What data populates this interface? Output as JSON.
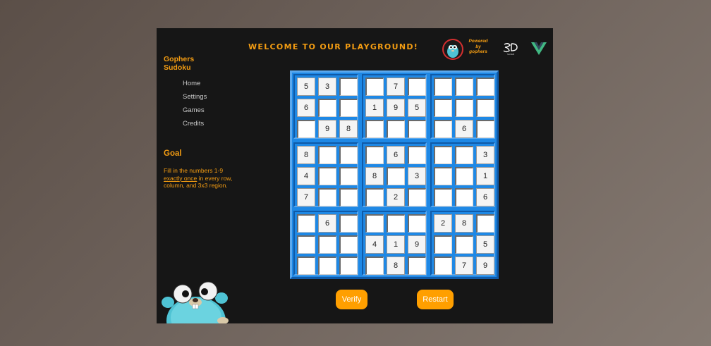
{
  "sidebar": {
    "brand": "Gophers Sudoku",
    "nav": [
      "Home",
      "Settings",
      "Games",
      "Credits"
    ],
    "goal_title": "Goal",
    "goal_text_before": "Fill in the numbers 1-9 ",
    "goal_text_emphasis": "exactly once",
    "goal_text_after": " in every row, column, and 3x3 region."
  },
  "header": {
    "title": "WELCOME TO OUR PLAYGROUND!",
    "powered_line1": "Powered",
    "powered_line2": "by",
    "powered_line3": "gophers",
    "logo2_caption": "NAVEB"
  },
  "board": [
    [
      "5",
      "3",
      "",
      "",
      "7",
      "",
      "",
      "",
      ""
    ],
    [
      "6",
      "",
      "",
      "1",
      "9",
      "5",
      "",
      "",
      ""
    ],
    [
      "",
      "9",
      "8",
      "",
      "",
      "",
      "",
      "6",
      ""
    ],
    [
      "8",
      "",
      "",
      "",
      "6",
      "",
      "",
      "",
      "3"
    ],
    [
      "4",
      "",
      "",
      "8",
      "",
      "3",
      "",
      "",
      "1"
    ],
    [
      "7",
      "",
      "",
      "",
      "2",
      "",
      "",
      "",
      "6"
    ],
    [
      "",
      "6",
      "",
      "",
      "",
      "",
      "2",
      "8",
      ""
    ],
    [
      "",
      "",
      "",
      "4",
      "1",
      "9",
      "",
      "",
      "5"
    ],
    [
      "",
      "",
      "",
      "",
      "8",
      "",
      "",
      "7",
      "9"
    ]
  ],
  "buttons": {
    "verify": "Verify",
    "restart": "Restart"
  },
  "colors": {
    "accent": "#f39c12",
    "board_blue": "#1E88E5",
    "button": "#FF9F00",
    "app_bg": "#161616",
    "vue_green": "#41B883",
    "vue_dark": "#34495E"
  },
  "icons": [
    "gopher-mascot-icon",
    "gopher-badge-icon",
    "logo-3d-icon",
    "vue-logo-icon"
  ]
}
